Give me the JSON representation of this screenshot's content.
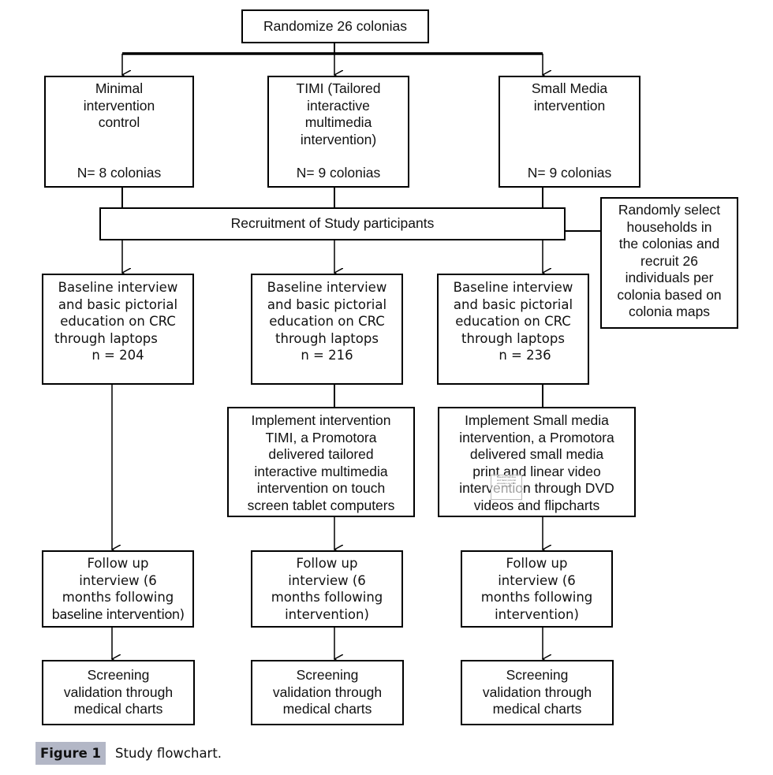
{
  "diagram": {
    "type": "flowchart",
    "randomize": {
      "text": "Randomize 26 colonias"
    },
    "arms": [
      {
        "id": "minimal",
        "arm_title": [
          "Minimal",
          "intervention",
          "control"
        ],
        "arm_n": "N= 8 colonias",
        "baseline": [
          "Baseline interview",
          "and basic pictorial",
          "education on CRC",
          "through laptops",
          "n = 204"
        ],
        "implement": null,
        "followup": [
          "Follow up",
          "interview (6",
          "months following",
          "baseline intervention)"
        ],
        "screening": [
          "Screening",
          "validation through",
          "medical charts"
        ]
      },
      {
        "id": "timi",
        "arm_title": [
          "TIMI (Tailored",
          "interactive",
          "multimedia",
          "intervention)"
        ],
        "arm_n": "N= 9 colonias",
        "baseline": [
          "Baseline interview",
          "and basic pictorial",
          "education on CRC",
          "through laptops",
          "n = 216"
        ],
        "implement": [
          "Implement intervention",
          "TIMI, a Promotora",
          "delivered tailored",
          "interactive multimedia",
          "intervention on touch",
          "screen tablet computers"
        ],
        "followup": [
          "Follow up",
          "interview (6",
          "months following",
          "intervention)"
        ],
        "screening": [
          "Screening",
          "validation through",
          "medical charts"
        ]
      },
      {
        "id": "small-media",
        "arm_title": [
          "Small Media",
          "intervention"
        ],
        "arm_n": "N= 9 colonias",
        "baseline": [
          "Baseline interview",
          "and basic pictorial",
          "education on CRC",
          "through laptops",
          "n =  236"
        ],
        "implement": [
          "Implement Small media",
          "intervention, a Promotora",
          "delivered small media",
          "print and linear video",
          "intervention through DVD",
          "videos and flipcharts"
        ],
        "followup": [
          "Follow up",
          "interview (6",
          "months following",
          "intervention)"
        ],
        "screening": [
          "Screening",
          "validation through",
          "medical charts"
        ]
      }
    ],
    "recruitment": {
      "text": "Recruitment of Study participants"
    },
    "recruitment_note": [
      "Randomly select",
      "households in",
      "the colonias and",
      "recruit 26",
      "individuals per",
      "colonia based on",
      "colonia maps"
    ],
    "ghost_artifact": [
      "Baseline interview",
      "and basic pictorial",
      "education on CRC",
      "n = 216"
    ]
  },
  "caption": {
    "label": "Figure 1",
    "text": "Study flowchart."
  }
}
